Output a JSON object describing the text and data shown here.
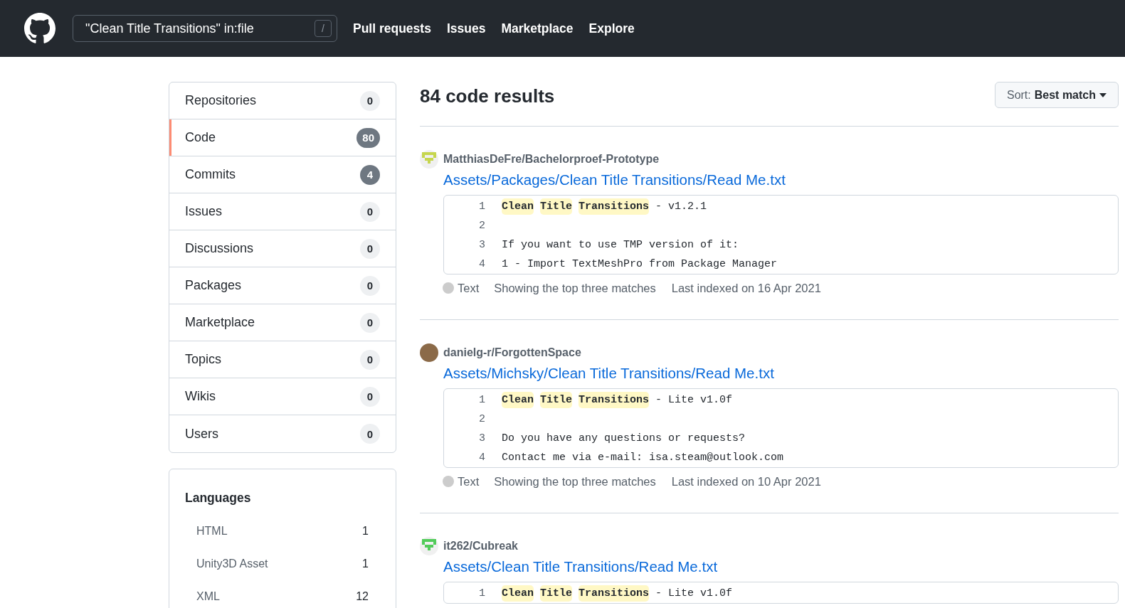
{
  "header": {
    "search": {
      "value": "\"Clean Title Transitions\" in:file",
      "shortcut": "/"
    },
    "nav": [
      "Pull requests",
      "Issues",
      "Marketplace",
      "Explore"
    ]
  },
  "sidebar": {
    "filters": [
      {
        "label": "Repositories",
        "count": "0",
        "selected": false,
        "prominent": false
      },
      {
        "label": "Code",
        "count": "80",
        "selected": true,
        "prominent": true
      },
      {
        "label": "Commits",
        "count": "4",
        "selected": false,
        "prominent": true
      },
      {
        "label": "Issues",
        "count": "0",
        "selected": false,
        "prominent": false
      },
      {
        "label": "Discussions",
        "count": "0",
        "selected": false,
        "prominent": false
      },
      {
        "label": "Packages",
        "count": "0",
        "selected": false,
        "prominent": false
      },
      {
        "label": "Marketplace",
        "count": "0",
        "selected": false,
        "prominent": false
      },
      {
        "label": "Topics",
        "count": "0",
        "selected": false,
        "prominent": false
      },
      {
        "label": "Wikis",
        "count": "0",
        "selected": false,
        "prominent": false
      },
      {
        "label": "Users",
        "count": "0",
        "selected": false,
        "prominent": false
      }
    ],
    "languages": {
      "title": "Languages",
      "items": [
        {
          "name": "HTML",
          "count": "1"
        },
        {
          "name": "Unity3D Asset",
          "count": "1"
        },
        {
          "name": "XML",
          "count": "12"
        }
      ]
    }
  },
  "results": {
    "title": "84 code results",
    "sort": "Sort: **Best match**",
    "items": [
      {
        "avatar": {
          "kind": "identicon",
          "color": "#c6d64e"
        },
        "repo": "MatthiasDeFre/Bachelorproef-Prototype",
        "path": "Assets/Packages/Clean Title Transitions/Read Me.txt",
        "lines": [
          {
            "number": "1",
            "code": "**Clean** **Title** **Transitions** - v1.2.1"
          },
          {
            "number": "2"
          },
          {
            "number": "3",
            "code": "If you want to use TMP version of it:"
          },
          {
            "number": "4",
            "code": "1 - Import TextMeshPro from Package Manager"
          }
        ],
        "language": {
          "name": "Text",
          "color": "#cccccc"
        },
        "note": "Showing the top three matches",
        "indexed": "Last indexed on 16 Apr 2021"
      },
      {
        "avatar": {
          "kind": "photo"
        },
        "repo": "danielg-r/ForgottenSpace",
        "path": "Assets/Michsky/Clean Title Transitions/Read Me.txt",
        "lines": [
          {
            "number": "1",
            "code": "**Clean** **Title** **Transitions** - Lite v1.0f"
          },
          {
            "number": "2"
          },
          {
            "number": "3",
            "code": "Do you have any questions or requests?"
          },
          {
            "number": "4",
            "code": "Contact me via e-mail: isa.steam@outlook.com"
          }
        ],
        "language": {
          "name": "Text",
          "color": "#cccccc"
        },
        "note": "Showing the top three matches",
        "indexed": "Last indexed on 10 Apr 2021"
      },
      {
        "avatar": {
          "kind": "identicon",
          "color": "#52cc5a"
        },
        "repo": "it262/Cubreak",
        "path": "Assets/Clean Title Transitions/Read Me.txt",
        "lines": [
          {
            "number": "1",
            "code": "**Clean** **Title** **Transitions** - Lite v1.0f"
          }
        ]
      }
    ]
  }
}
